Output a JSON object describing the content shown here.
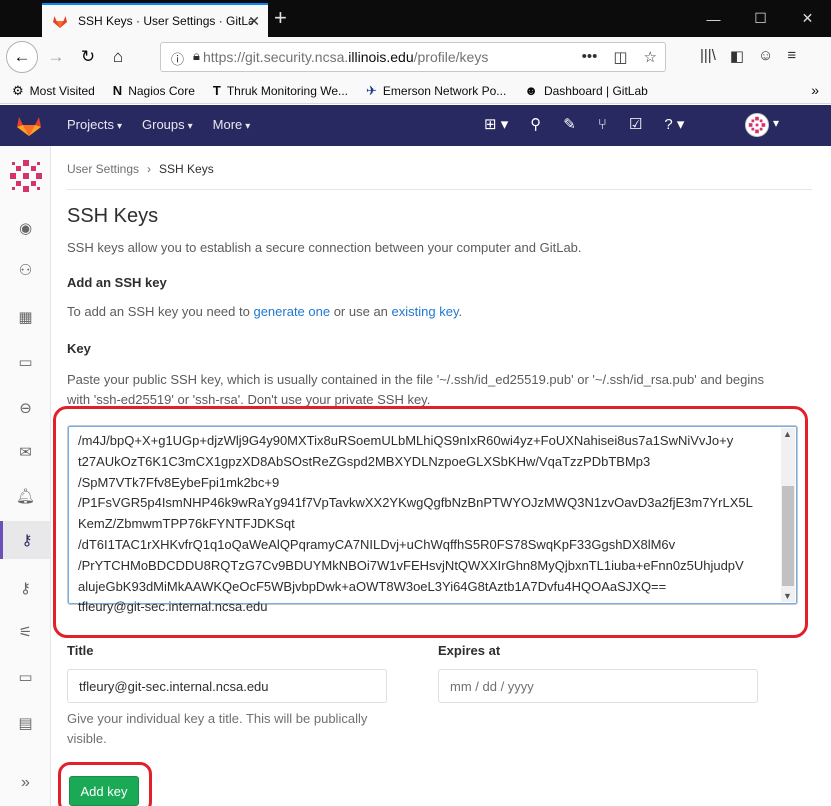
{
  "browser": {
    "tab_title": "SSH Keys · User Settings · GitLab",
    "tab_close": "✕",
    "new_tab": "+",
    "url_prefix": "https://git.security.ncsa.",
    "url_host": "illinois.edu",
    "url_path": "/profile/keys",
    "window_buttons": [
      "—",
      "☐",
      "✕"
    ],
    "bookmarks": [
      {
        "icon": "gear-icon",
        "glyph": "⚙",
        "label": "Most Visited"
      },
      {
        "icon": "nagios-icon",
        "glyph": "N",
        "label": "Nagios Core"
      },
      {
        "icon": "thruk-icon",
        "glyph": "T",
        "label": "Thruk Monitoring We..."
      },
      {
        "icon": "emerson-icon",
        "glyph": "✈",
        "label": "Emerson Network Po..."
      },
      {
        "icon": "gitlab-icon",
        "glyph": "☻",
        "label": "Dashboard | GitLab"
      }
    ]
  },
  "gitlab_header": {
    "menu": [
      "Projects",
      "Groups",
      "More"
    ],
    "colors": {
      "header_bg": "#292961",
      "accent": "#6b4fbb"
    }
  },
  "breadcrumb": {
    "parent": "User Settings",
    "separator": "›",
    "current": "SSH Keys"
  },
  "page": {
    "title": "SSH Keys",
    "description": "SSH keys allow you to establish a secure connection between your computer and GitLab.",
    "add_title": "Add an SSH key",
    "add_desc_pre": "To add an SSH key you need to ",
    "add_link_1": "generate one",
    "add_desc_mid": " or use an ",
    "add_link_2": "existing key",
    "add_desc_end": ".",
    "key_label": "Key",
    "key_help": "Paste your public SSH key, which is usually contained in the file '~/.ssh/id_ed25519.pub' or '~/.ssh/id_rsa.pub' and begins with 'ssh-ed25519' or 'ssh-rsa'. Don't use your private SSH key.",
    "key_value": "/m4J/bpQ+X+g1UGp+djzWlj9G4y90MXTix8uRSoemULbMLhiQS9nIxR60wi4yz+FoUXNahisei8us7a1SwNiVvJo+y\nt27AUkOzT6K1C3mCX1gpzXD8AbSOstReZGspd2MBXYDLNzpoeGLXSbKHw/VqaTzzPDbTBMp3\n/SpM7VTk7Ffv8EybeFpi1mk2bc+9\n/P1FsVGR5p4IsmNHP46k9wRaYg941f7VpTavkwXX2YKwgQgfbNzBnPTWYOJzMWQ3N1zvOavD3a2fjE3m7YrLX5L\nKemZ/ZbmwmTPP76kFYNTFJDKSqt\n/dT6I1TAC1rXHKvfrQ1q1oQaWeAlQPqramyCA7NILDvj+uChWqffhS5R0FS78SwqKpF33GgshDX8lM6v\n/PrYTCHMoBDCDDU8RQTzG7Cv9BDUYMkNBOi7W1vFEHsvjNtQWXXIrGhn8MyQjbxnTL1iuba+eFnn0z5UhjudpV\nalujeGbK93dMiMkAAWKQeOcF5WBjvbpDwk+aOWT8W3oeL3Yi64G8tAztb1A7Dvfu4HQOAaSJXQ==\ntfleury@git-sec.internal.ncsa.edu",
    "title_label": "Title",
    "title_value": "tfleury@git-sec.internal.ncsa.edu",
    "title_help": "Give your individual key a title. This will be publically visible.",
    "expires_label": "Expires at",
    "expires_placeholder": "mm / dd / yyyy",
    "add_button": "Add key"
  }
}
